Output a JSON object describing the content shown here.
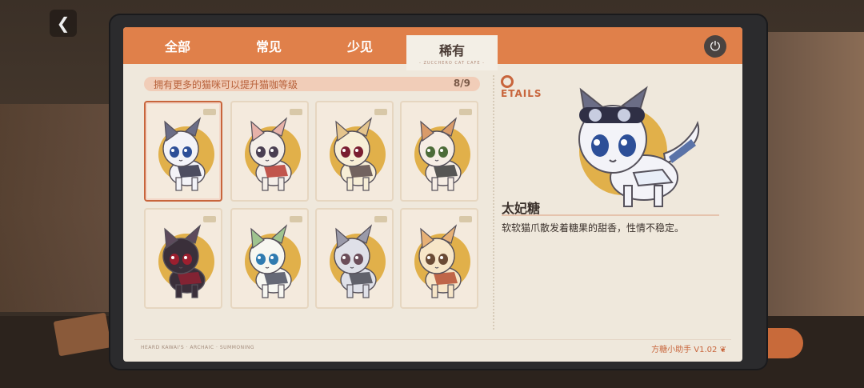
{
  "tabs": [
    {
      "label": "全部"
    },
    {
      "label": "常见"
    },
    {
      "label": "少见"
    },
    {
      "label": "稀有",
      "subtitle": "- ZUCCHERO CAT CAFE -",
      "active": true
    }
  ],
  "banner": {
    "text": "拥有更多的猫咪可以提升猫咖等级",
    "count": "8/9"
  },
  "cats": [
    {
      "id": 1,
      "colors": {
        "fur": "#f3f3f8",
        "ear": "#6b6d86",
        "eye": "#2d4f98",
        "accent": "#2f2f45"
      }
    },
    {
      "id": 2,
      "colors": {
        "fur": "#f4eee8",
        "ear": "#e7b2a9",
        "eye": "#4a3f52",
        "accent": "#b73a30"
      }
    },
    {
      "id": 3,
      "colors": {
        "fur": "#f7eed6",
        "ear": "#e4c48c",
        "eye": "#7a1e31",
        "accent": "#5a4a4a"
      }
    },
    {
      "id": 4,
      "colors": {
        "fur": "#f6ede4",
        "ear": "#d99b69",
        "eye": "#4c6b38",
        "accent": "#3b3b3b"
      }
    },
    {
      "id": 5,
      "colors": {
        "fur": "#3a2f3a",
        "ear": "#5d4a5c",
        "eye": "#9c1f2f",
        "accent": "#8f2133"
      }
    },
    {
      "id": 6,
      "colors": {
        "fur": "#f7f7f1",
        "ear": "#9fc48f",
        "eye": "#2f7bb0",
        "accent": "#4b5060"
      }
    },
    {
      "id": 7,
      "colors": {
        "fur": "#dfe0e8",
        "ear": "#9a9aa9",
        "eye": "#6b4d59",
        "accent": "#4a4a55"
      }
    },
    {
      "id": 8,
      "colors": {
        "fur": "#f7e6c8",
        "ear": "#e7b176",
        "eye": "#6b4b35",
        "accent": "#b54f33"
      }
    }
  ],
  "details": {
    "logo": "ETAILS",
    "name": "太妃糖",
    "description": "软软猫爪散发着糖果的甜香，性情不稳定。"
  },
  "footer": {
    "left_info": "HEARD KAWAI'S · ARCHAIC · SUMMONING",
    "version": "方糖小助手 V1.02"
  },
  "icons": [
    "chevron-left-icon",
    "power-icon",
    "paw-icon"
  ]
}
